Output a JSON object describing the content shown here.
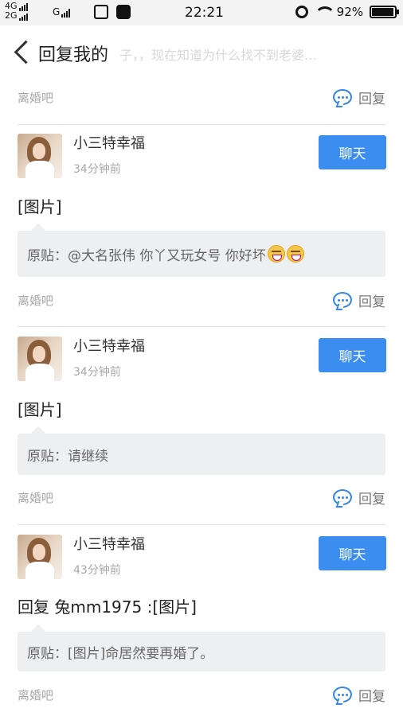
{
  "status_bar": {
    "net_top": "4G",
    "net_bottom": "2G",
    "net_g": "G",
    "time": "22:21",
    "battery": "92%"
  },
  "header": {
    "title": "回复我的",
    "ghost_text": "子，，现在知道为什么找不到老婆…"
  },
  "colors": {
    "accent": "#3b8ef0",
    "muted": "#a8a8a8"
  },
  "forum_label": "离婚吧",
  "reply_label": "回复",
  "chat_label": "聊天",
  "posts": [
    {
      "user": "小三特幸福",
      "time": "34分钟前",
      "content": "[图片]",
      "original": "原贴：@大名张伟 你丫又玩女号 你好坏"
    },
    {
      "user": "小三特幸福",
      "time": "34分钟前",
      "content": "[图片]",
      "original": "原贴：请继续"
    },
    {
      "user": "小三特幸福",
      "time": "43分钟前",
      "content": "回复 兔mm1975 :[图片]",
      "original": "原贴：[图片]命居然要再婚了。"
    }
  ]
}
